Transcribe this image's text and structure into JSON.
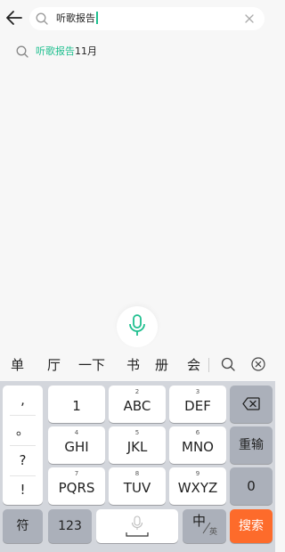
{
  "search": {
    "query": "听歌报告"
  },
  "suggestion": {
    "highlight": "听歌报告",
    "rest": "11月"
  },
  "candidates": [
    "单",
    "厅",
    "一下",
    "书",
    "册",
    "会"
  ],
  "punctuation": [
    ",",
    "。",
    "?",
    "!"
  ],
  "keys": {
    "row1": [
      {
        "num": "",
        "label": "1"
      },
      {
        "num": "2",
        "label": "ABC"
      },
      {
        "num": "3",
        "label": "DEF"
      }
    ],
    "row2": [
      {
        "num": "4",
        "label": "GHI"
      },
      {
        "num": "5",
        "label": "JKL"
      },
      {
        "num": "6",
        "label": "MNO"
      }
    ],
    "row3": [
      {
        "num": "7",
        "label": "PQRS"
      },
      {
        "num": "8",
        "label": "TUV"
      },
      {
        "num": "9",
        "label": "WXYZ"
      }
    ],
    "reenter": "重输",
    "zero": "0",
    "symbols": "符",
    "numbers": "123",
    "lang_main": "中",
    "lang_sub": "英",
    "search": "搜索"
  },
  "colors": {
    "accent": "#1fbf8f",
    "search_key": "#fd6b2b"
  }
}
